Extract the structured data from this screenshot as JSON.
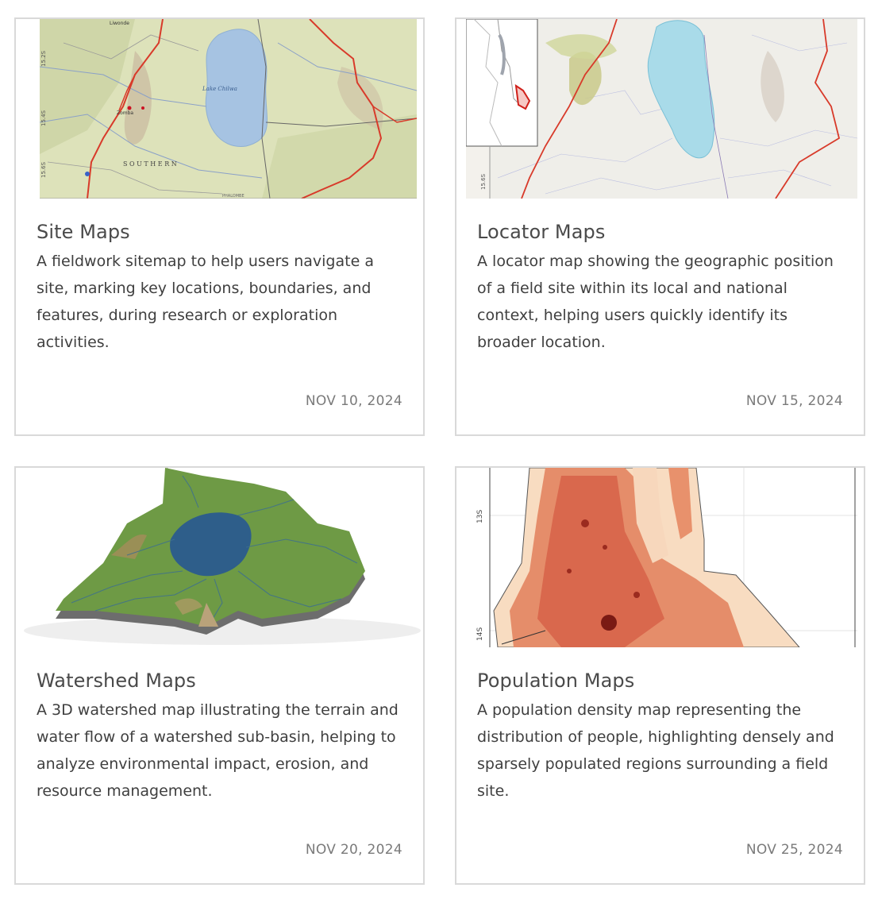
{
  "cards": [
    {
      "title": "Site Maps",
      "description": "A fieldwork sitemap to help users navigate a site, marking key locations, boundaries, and features, during research or exploration activities.",
      "date": "NOV 10, 2024",
      "map_labels": {
        "lake": "Lake Chilwa",
        "region": "S O U T H E R N",
        "town": "Zomba",
        "place1": "Liwonde",
        "place2": "PHALOMBE",
        "lat1": "15.2S",
        "lat2": "15.4S",
        "lat3": "15.6S"
      }
    },
    {
      "title": "Locator Maps",
      "description": "A locator map showing the geographic position of a field site within its local and national context, helping users quickly identify its broader location.",
      "date": "NOV 15, 2024",
      "map_labels": {
        "lat": "15.6S"
      }
    },
    {
      "title": "Watershed Maps",
      "description": "A 3D watershed map illustrating the terrain and water flow of a watershed sub-basin, helping to analyze environmental impact, erosion, and resource management.",
      "date": "NOV 20, 2024"
    },
    {
      "title": "Population Maps",
      "description": "A population density map representing the distribution of people, highlighting densely and sparsely populated regions surrounding a field site.",
      "date": "NOV 25, 2024",
      "map_labels": {
        "lat1": "13S",
        "lat2": "14S"
      }
    }
  ],
  "colors": {
    "border": "#d9d9d9",
    "title": "#4a4a4a",
    "date": "#7a7a7a",
    "road": "#d83a2a",
    "lake": "#9dbfe0",
    "land": "#dfe2bd"
  }
}
